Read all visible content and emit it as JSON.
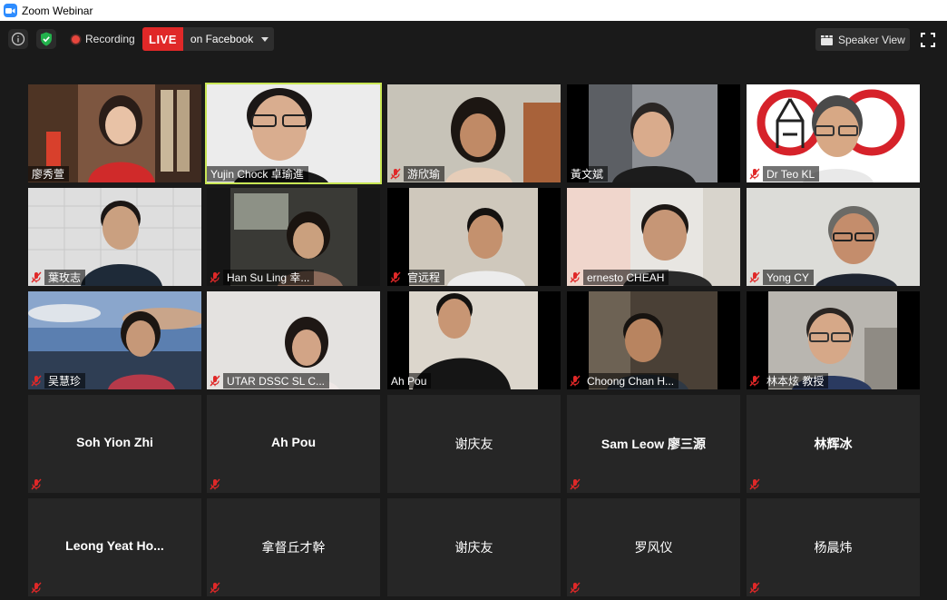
{
  "window": {
    "title": "Zoom Webinar"
  },
  "topbar": {
    "recording_label": "Recording",
    "live_label": "LIVE",
    "live_target": "on Facebook",
    "view_label": "Speaker View"
  },
  "colors": {
    "accent_live": "#e02828",
    "active_speaker": "#c8e654",
    "shield": "#22b14c",
    "mute": "#e02828"
  },
  "icons": [
    "info-icon",
    "shield-check-icon",
    "recording-dot-icon",
    "chevron-down-icon",
    "grid-view-icon",
    "fullscreen-icon",
    "mic-muted-icon"
  ],
  "participants": [
    {
      "name": "廖秀萱",
      "muted": false
    },
    {
      "name": "Yujin Chock 卓瑜進",
      "muted": false,
      "active": true
    },
    {
      "name": "游欣瑜",
      "muted": true
    },
    {
      "name": "黃文斌",
      "muted": false
    },
    {
      "name": "Dr Teo KL",
      "muted": true
    },
    {
      "name": "葉玫志",
      "muted": true
    },
    {
      "name": "Han Su Ling 幸...",
      "muted": true
    },
    {
      "name": "官远程",
      "muted": true
    },
    {
      "name": "ernesto CHEAH",
      "muted": true
    },
    {
      "name": "Yong CY",
      "muted": true
    },
    {
      "name": "吴慧珍",
      "muted": true
    },
    {
      "name": "UTAR DSSC SL C...",
      "muted": true
    },
    {
      "name": "Ah Pou",
      "muted": false
    },
    {
      "name": "Choong Chan H...",
      "muted": true
    },
    {
      "name": "林本炫 教授",
      "muted": true
    }
  ],
  "no_video": [
    {
      "name": "Soh Yion Zhi"
    },
    {
      "name": "Ah Pou"
    },
    {
      "name": "谢庆友"
    },
    {
      "name": "Sam  Leow 廖三源"
    },
    {
      "name": "林辉冰"
    },
    {
      "name": "Leong  Yeat  Ho..."
    },
    {
      "name": "拿督丘才幹"
    },
    {
      "name": "谢庆友"
    },
    {
      "name": "罗风仪"
    },
    {
      "name": "杨晨炜"
    }
  ]
}
